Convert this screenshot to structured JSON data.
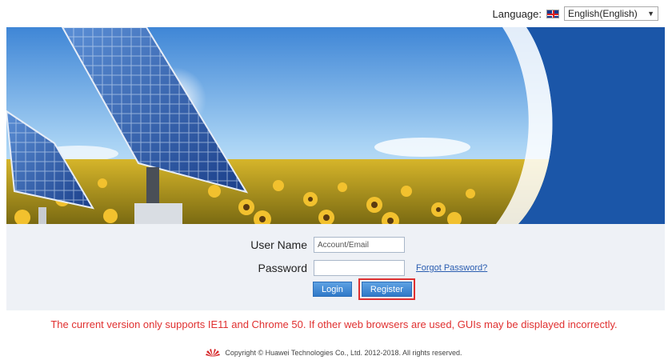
{
  "language": {
    "label": "Language:",
    "selected": "English(English)",
    "icon": "uk-flag-icon"
  },
  "login": {
    "username_label": "User Name",
    "username_placeholder": "Account/Email",
    "password_label": "Password",
    "forgot_link": "Forgot Password?",
    "login_button": "Login",
    "register_button": "Register"
  },
  "notice": "The current version only supports IE11 and Chrome 50. If other web browsers are used, GUIs may be displayed incorrectly.",
  "copyright": "Copyright © Huawei Technologies Co., Ltd. 2012-2018. All rights reserved.",
  "colors": {
    "accent": "#2f79c8",
    "notice": "#e03030",
    "panel": "#eef1f6"
  }
}
